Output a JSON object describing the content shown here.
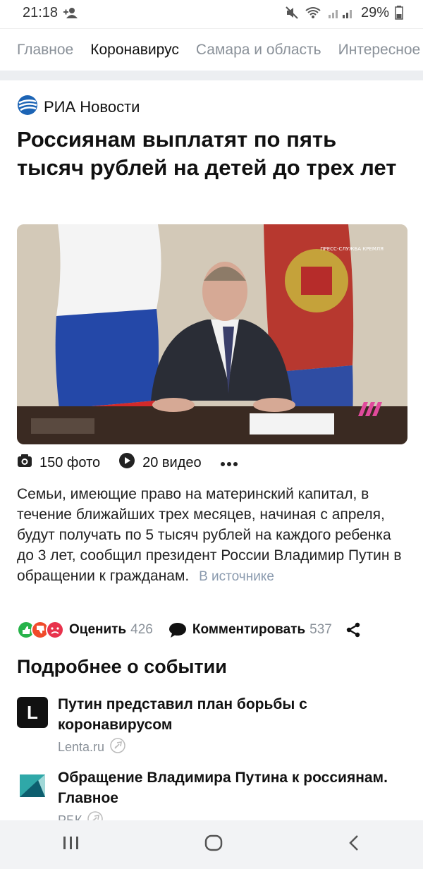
{
  "status_bar": {
    "time": "21:18",
    "battery": "29%"
  },
  "tabs": [
    {
      "label": "Главное"
    },
    {
      "label": "Коронавирус"
    },
    {
      "label": "Самара и область"
    },
    {
      "label": "Интересное"
    }
  ],
  "article": {
    "source_name": "РИА Новости",
    "headline": "Россиянам выплатят по пять тысяч рублей на детей до трех лет",
    "photo_count": "150 фото",
    "video_count": "20 видео",
    "summary": "Семьи, имеющие право на материнский капитал, в течение ближайших трех месяцев, начиная с апреля, будут получать по 5 тысяч рублей на каждого ребенка до 3 лет, сообщил президент России Владимир Путин в обращении к гражданам.",
    "source_link": "В источнике"
  },
  "actions": {
    "rate_label": "Оценить",
    "rate_count": "426",
    "comment_label": "Комментировать",
    "comment_count": "537"
  },
  "related": {
    "title": "Подробнее о событии",
    "items": [
      {
        "title": "Путин представил план борьбы с коронавирусом",
        "source": "Lenta.ru",
        "logo_letter": "L"
      },
      {
        "title": "Обращение Владимира Путина к россиянам. Главное",
        "source": "РБК"
      }
    ]
  },
  "colors": {
    "accent_blue": "#1c64b5",
    "muted": "#8a9199",
    "link": "#8a9aae"
  }
}
